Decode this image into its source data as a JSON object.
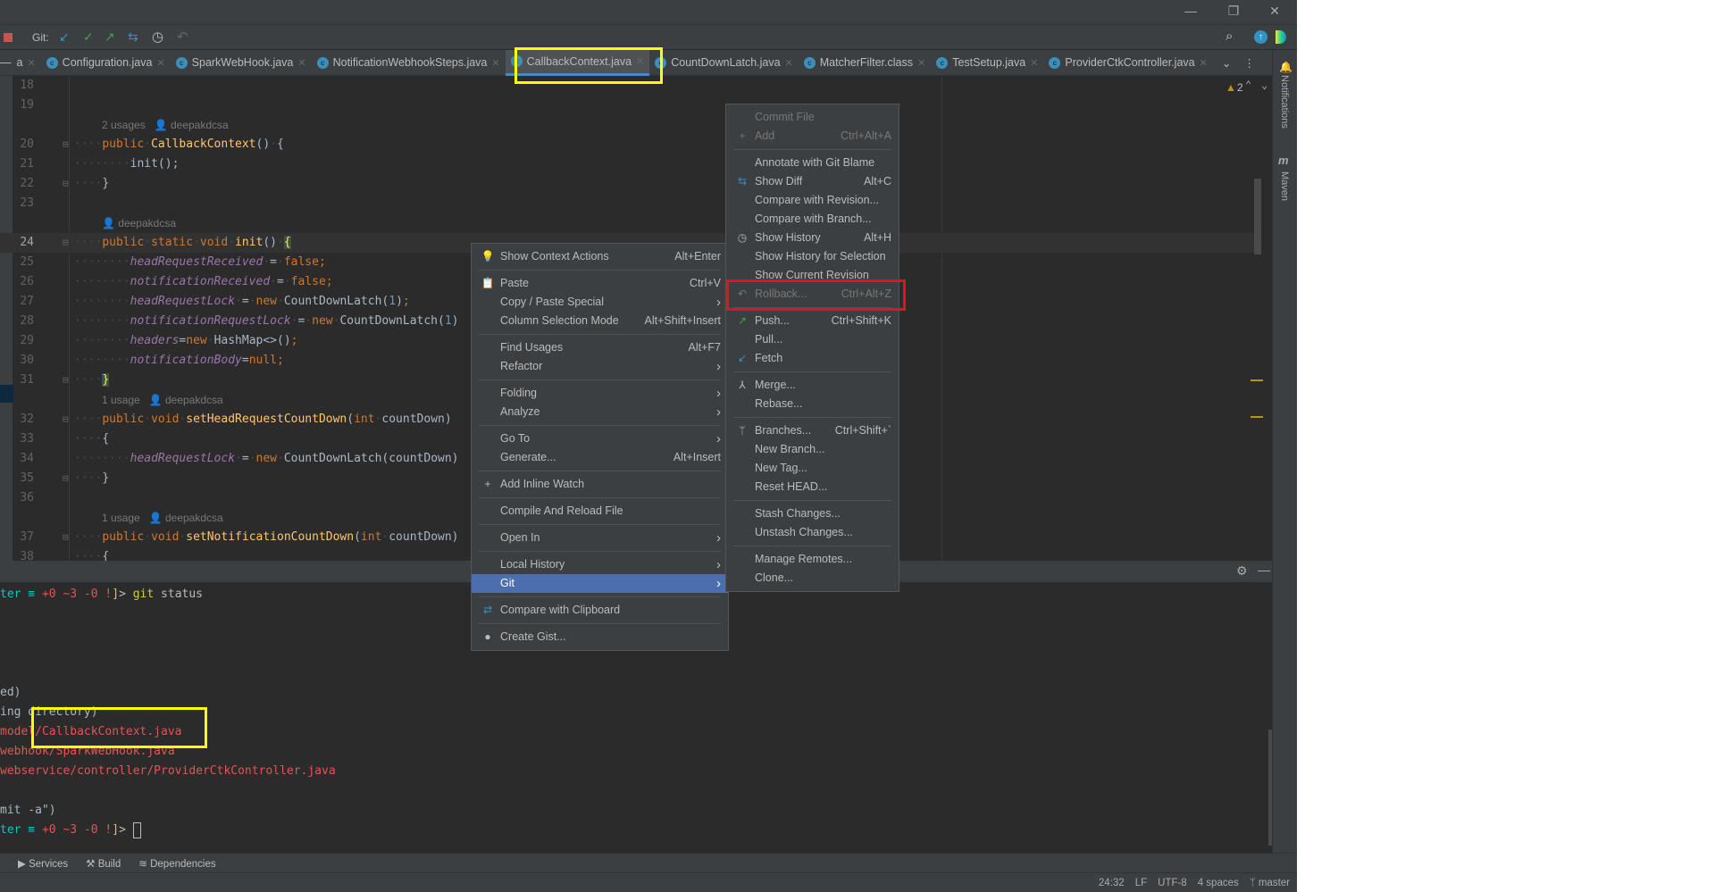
{
  "window": {
    "minimize": "—",
    "restore": "❐",
    "close": "✕"
  },
  "toolbar": {
    "git_label": "Git:",
    "icons": [
      "update-project-icon",
      "commit-icon",
      "push-icon",
      "show-diff-icon",
      "history-icon",
      "rollback-icon"
    ]
  },
  "tabs": [
    {
      "label": "a",
      "clipped": true
    },
    {
      "label": "Configuration.java"
    },
    {
      "label": "SparkWebHook.java"
    },
    {
      "label": "NotificationWebhookSteps.java"
    },
    {
      "label": "CallbackContext.java",
      "active": true
    },
    {
      "label": "CountDownLatch.java"
    },
    {
      "label": "MatcherFilter.class"
    },
    {
      "label": "TestSetup.java"
    },
    {
      "label": "ProviderCtkController.java"
    }
  ],
  "editor": {
    "warnings": "2",
    "left_clip": "ool",
    "rows": [
      {
        "ln": "18",
        "t": []
      },
      {
        "ln": "19",
        "t": []
      },
      {
        "hint": "2 usages   👤 deepakdcsa"
      },
      {
        "ln": "20",
        "t": [
          [
            "dot",
            "····"
          ],
          [
            "kw",
            "public"
          ],
          [
            "dot",
            "·"
          ],
          [
            "fn",
            "CallbackContext"
          ],
          [
            "txt",
            "()"
          ],
          [
            "dot",
            "·"
          ],
          [
            "txt",
            "{"
          ]
        ]
      },
      {
        "ln": "21",
        "t": [
          [
            "dot",
            "········"
          ],
          [
            "txt",
            "init();"
          ]
        ]
      },
      {
        "ln": "22",
        "t": [
          [
            "dot",
            "····"
          ],
          [
            "txt",
            "}"
          ]
        ]
      },
      {
        "ln": "23",
        "t": []
      },
      {
        "hint": "👤 deepakdcsa"
      },
      {
        "ln": "24",
        "cur": true,
        "t": [
          [
            "dot",
            "····"
          ],
          [
            "kw",
            "public"
          ],
          [
            "dot",
            "·"
          ],
          [
            "kw",
            "static"
          ],
          [
            "dot",
            "·"
          ],
          [
            "kw",
            "void"
          ],
          [
            "dot",
            "·"
          ],
          [
            "fn",
            "init"
          ],
          [
            "txt",
            "()"
          ],
          [
            "dot",
            "·"
          ],
          [
            "brc",
            "{"
          ]
        ]
      },
      {
        "ln": "25",
        "t": [
          [
            "dot",
            "········"
          ],
          [
            "fld",
            "headRequestReceived"
          ],
          [
            "dot",
            "·"
          ],
          [
            "txt",
            "="
          ],
          [
            "dot",
            "·"
          ],
          [
            "kw",
            "false;"
          ]
        ]
      },
      {
        "ln": "26",
        "t": [
          [
            "dot",
            "········"
          ],
          [
            "fld",
            "notificationReceived"
          ],
          [
            "dot",
            "·"
          ],
          [
            "txt",
            "="
          ],
          [
            "dot",
            "·"
          ],
          [
            "kw",
            "false;"
          ]
        ]
      },
      {
        "ln": "27",
        "t": [
          [
            "dot",
            "········"
          ],
          [
            "fld",
            "headRequestLock"
          ],
          [
            "dot",
            "·"
          ],
          [
            "txt",
            "="
          ],
          [
            "dot",
            "·"
          ],
          [
            "kw",
            "new"
          ],
          [
            "dot",
            "·"
          ],
          [
            "txt",
            "CountDownLatch("
          ],
          [
            "num",
            "1"
          ],
          [
            "txt",
            ")"
          ],
          [
            "kw",
            ";"
          ]
        ]
      },
      {
        "ln": "28",
        "t": [
          [
            "dot",
            "········"
          ],
          [
            "fld",
            "notificationRequestLock"
          ],
          [
            "dot",
            "·"
          ],
          [
            "txt",
            "="
          ],
          [
            "dot",
            "·"
          ],
          [
            "kw",
            "new"
          ],
          [
            "dot",
            "·"
          ],
          [
            "txt",
            "CountDownLatch("
          ],
          [
            "num",
            "1"
          ],
          [
            "txt",
            ")"
          ]
        ]
      },
      {
        "ln": "29",
        "t": [
          [
            "dot",
            "········"
          ],
          [
            "fld",
            "headers"
          ],
          [
            "txt",
            "="
          ],
          [
            "kw",
            "new"
          ],
          [
            "dot",
            "·"
          ],
          [
            "txt",
            "HashMap<>()"
          ],
          [
            "kw",
            ";"
          ]
        ]
      },
      {
        "ln": "30",
        "t": [
          [
            "dot",
            "········"
          ],
          [
            "fld",
            "notificationBody"
          ],
          [
            "txt",
            "="
          ],
          [
            "kw",
            "null;"
          ]
        ]
      },
      {
        "ln": "31",
        "t": [
          [
            "dot",
            "····"
          ],
          [
            "brc",
            "}"
          ]
        ]
      },
      {
        "hint": "1 usage   👤 deepakdcsa"
      },
      {
        "ln": "32",
        "t": [
          [
            "dot",
            "····"
          ],
          [
            "kw",
            "public"
          ],
          [
            "dot",
            "·"
          ],
          [
            "kw",
            "void"
          ],
          [
            "dot",
            "·"
          ],
          [
            "fn",
            "setHeadRequestCountDown"
          ],
          [
            "txt",
            "("
          ],
          [
            "kw",
            "int"
          ],
          [
            "dot",
            "·"
          ],
          [
            "txt",
            "countDown)"
          ]
        ]
      },
      {
        "ln": "33",
        "t": [
          [
            "dot",
            "····"
          ],
          [
            "txt",
            "{"
          ]
        ]
      },
      {
        "ln": "34",
        "t": [
          [
            "dot",
            "········"
          ],
          [
            "fld",
            "headRequestLock"
          ],
          [
            "dot",
            "·"
          ],
          [
            "txt",
            "="
          ],
          [
            "dot",
            "·"
          ],
          [
            "kw",
            "new"
          ],
          [
            "dot",
            "·"
          ],
          [
            "txt",
            "CountDownLatch(countDown)"
          ]
        ]
      },
      {
        "ln": "35",
        "t": [
          [
            "dot",
            "····"
          ],
          [
            "txt",
            "}"
          ]
        ]
      },
      {
        "ln": "36",
        "t": []
      },
      {
        "hint": "1 usage   👤 deepakdcsa"
      },
      {
        "ln": "37",
        "t": [
          [
            "dot",
            "····"
          ],
          [
            "kw",
            "public"
          ],
          [
            "dot",
            "·"
          ],
          [
            "kw",
            "void"
          ],
          [
            "dot",
            "·"
          ],
          [
            "fn",
            "setNotificationCountDown"
          ],
          [
            "txt",
            "("
          ],
          [
            "kw",
            "int"
          ],
          [
            "dot",
            "·"
          ],
          [
            "txt",
            "countDown)"
          ]
        ]
      },
      {
        "ln": "38",
        "t": [
          [
            "dot",
            "····"
          ],
          [
            "txt",
            "{"
          ]
        ]
      }
    ]
  },
  "terminal": {
    "lines": [
      [
        [
          "cy",
          "ter ≡ "
        ],
        [
          "rd",
          "+0 ~3 -0 !"
        ],
        [
          "yl",
          "]"
        ],
        [
          "wh",
          "> "
        ],
        [
          "yl",
          "git "
        ],
        [
          "wh",
          "status"
        ]
      ],
      [],
      [],
      [],
      [],
      [
        [
          "gy",
          "ed)"
        ]
      ],
      [
        [
          "gy",
          "ing directory)"
        ]
      ],
      [
        [
          "rd",
          "model/CallbackContext.java"
        ]
      ],
      [
        [
          "rd",
          "webhook/SparkWebHook.java"
        ]
      ],
      [
        [
          "rd",
          "webservice/controller/ProviderCtkController.java"
        ]
      ],
      [],
      [
        [
          "gy",
          "mit -a\")"
        ]
      ],
      [
        [
          "cy",
          "ter ≡ "
        ],
        [
          "rd",
          "+0 ~3 -0 !"
        ],
        [
          "yl",
          "]"
        ],
        [
          "wh",
          "> "
        ]
      ]
    ]
  },
  "context_menu": {
    "items": [
      {
        "label": "Show Context Actions",
        "shortcut": "Alt+Enter",
        "icon": "lightbulb-icon",
        "glyph": "💡"
      },
      {
        "sep": true
      },
      {
        "label": "Paste",
        "shortcut": "Ctrl+V",
        "icon": "clipboard-icon",
        "glyph": "📋"
      },
      {
        "label": "Copy / Paste Special",
        "submenu": true
      },
      {
        "label": "Column Selection Mode",
        "shortcut": "Alt+Shift+Insert"
      },
      {
        "sep": true
      },
      {
        "label": "Find Usages",
        "shortcut": "Alt+F7"
      },
      {
        "label": "Refactor",
        "submenu": true
      },
      {
        "sep": true
      },
      {
        "label": "Folding",
        "submenu": true
      },
      {
        "label": "Analyze",
        "submenu": true
      },
      {
        "sep": true
      },
      {
        "label": "Go To",
        "submenu": true
      },
      {
        "label": "Generate...",
        "shortcut": "Alt+Insert"
      },
      {
        "sep": true
      },
      {
        "label": "Add Inline Watch",
        "icon": "add-watch-icon",
        "glyph": "+"
      },
      {
        "sep": true
      },
      {
        "label": "Compile And Reload File"
      },
      {
        "sep": true
      },
      {
        "label": "Open In",
        "submenu": true
      },
      {
        "sep": true
      },
      {
        "label": "Local History",
        "submenu": true
      },
      {
        "label": "Git",
        "submenu": true,
        "selected": true
      },
      {
        "sep": true
      },
      {
        "label": "Compare with Clipboard",
        "icon": "compare-clipboard-icon",
        "glyph": "⇄"
      },
      {
        "sep": true
      },
      {
        "label": "Create Gist...",
        "icon": "github-icon",
        "glyph": "●"
      }
    ]
  },
  "git_menu": {
    "items": [
      {
        "label": "Commit File",
        "disabled": true
      },
      {
        "label": "Add",
        "shortcut": "Ctrl+Alt+A",
        "disabled": true,
        "icon": "plus-icon",
        "glyph": "+"
      },
      {
        "sep": true
      },
      {
        "label": "Annotate with Git Blame"
      },
      {
        "label": "Show Diff",
        "shortcut": "Alt+C",
        "icon": "diff-icon",
        "glyph": "⇆"
      },
      {
        "label": "Compare with Revision..."
      },
      {
        "label": "Compare with Branch..."
      },
      {
        "label": "Show History",
        "shortcut": "Alt+H",
        "icon": "clock-icon",
        "glyph": "◷"
      },
      {
        "label": "Show History for Selection"
      },
      {
        "label": "Show Current Revision"
      },
      {
        "label": "Rollback...",
        "shortcut": "Ctrl+Alt+Z",
        "disabled": true,
        "icon": "rollback-icon",
        "glyph": "↶"
      },
      {
        "sep": true
      },
      {
        "label": "Push...",
        "shortcut": "Ctrl+Shift+K",
        "icon": "push-arrow-icon",
        "glyph": "↗"
      },
      {
        "label": "Pull..."
      },
      {
        "label": "Fetch",
        "icon": "fetch-icon",
        "glyph": "↙"
      },
      {
        "sep": true
      },
      {
        "label": "Merge...",
        "icon": "merge-icon",
        "glyph": "⅄"
      },
      {
        "label": "Rebase..."
      },
      {
        "sep": true
      },
      {
        "label": "Branches...",
        "shortcut": "Ctrl+Shift+`",
        "icon": "branch-icon",
        "glyph": "ᛘ"
      },
      {
        "label": "New Branch..."
      },
      {
        "label": "New Tag..."
      },
      {
        "label": "Reset HEAD..."
      },
      {
        "sep": true
      },
      {
        "label": "Stash Changes..."
      },
      {
        "label": "Unstash Changes..."
      },
      {
        "sep": true
      },
      {
        "label": "Manage Remotes..."
      },
      {
        "label": "Clone..."
      }
    ]
  },
  "tool_windows": [
    {
      "label": "Services",
      "glyph": "▶"
    },
    {
      "label": "Build",
      "glyph": "⚒"
    },
    {
      "label": "Dependencies",
      "glyph": "≋"
    }
  ],
  "status_bar": {
    "position": "24:32",
    "line_sep": "LF",
    "encoding": "UTF-8",
    "indent": "4 spaces",
    "branch": "master"
  },
  "right_strip": {
    "notifications": "Notifications",
    "maven": "Maven"
  },
  "colors": {
    "accent": "#4b6eaf",
    "highlight_yellow": "#ffff00",
    "highlight_red": "#e3121c"
  }
}
